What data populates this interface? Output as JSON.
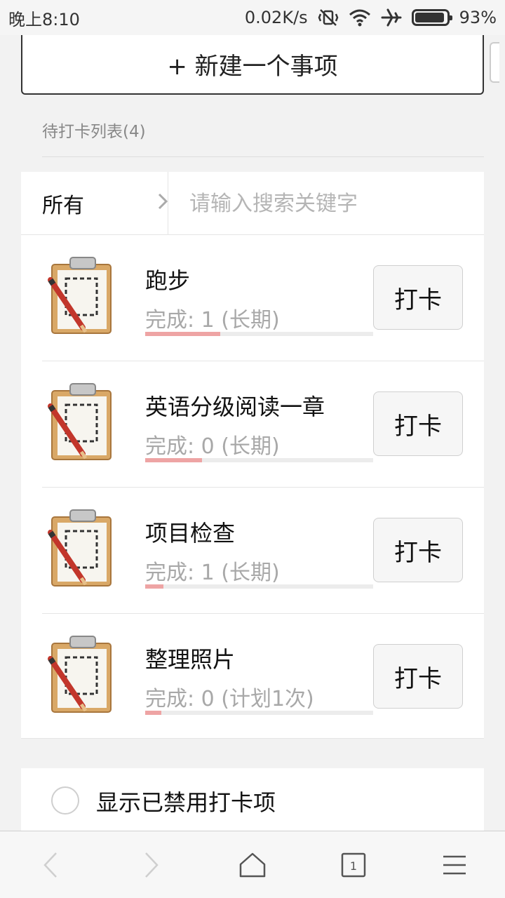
{
  "status_bar": {
    "time": "晚上8:10",
    "network_speed": "0.02K/s",
    "battery_percent": "93%",
    "icons": [
      "vibrate-off-icon",
      "wifi-icon",
      "airplane-icon",
      "battery-icon"
    ]
  },
  "new_item_button": {
    "label": "+ 新建一个事项"
  },
  "section": {
    "label": "待打卡列表(4)"
  },
  "filter": {
    "selected": "所有"
  },
  "search": {
    "placeholder": "请输入搜索关键字"
  },
  "items": [
    {
      "title": "跑步",
      "status": "完成: 1 (长期)",
      "progress": 0.33,
      "button_label": "打卡"
    },
    {
      "title": "英语分级阅读一章",
      "status": "完成: 0 (长期)",
      "progress": 0.25,
      "button_label": "打卡"
    },
    {
      "title": "项目检查",
      "status": "完成: 1 (长期)",
      "progress": 0.08,
      "button_label": "打卡"
    },
    {
      "title": "整理照片",
      "status": "完成: 0 (计划1次)",
      "progress": 0.07,
      "button_label": "打卡"
    }
  ],
  "toggle_disabled": {
    "label": "显示已禁用打卡项",
    "checked": false
  },
  "bottom_nav": {
    "tab_count": "1",
    "icons": [
      "back-icon",
      "forward-icon",
      "home-icon",
      "tabs-icon",
      "menu-icon"
    ]
  },
  "colors": {
    "progress_fill": "#eea4a4",
    "progress_track": "#ececec",
    "background": "#f2f2f2"
  }
}
